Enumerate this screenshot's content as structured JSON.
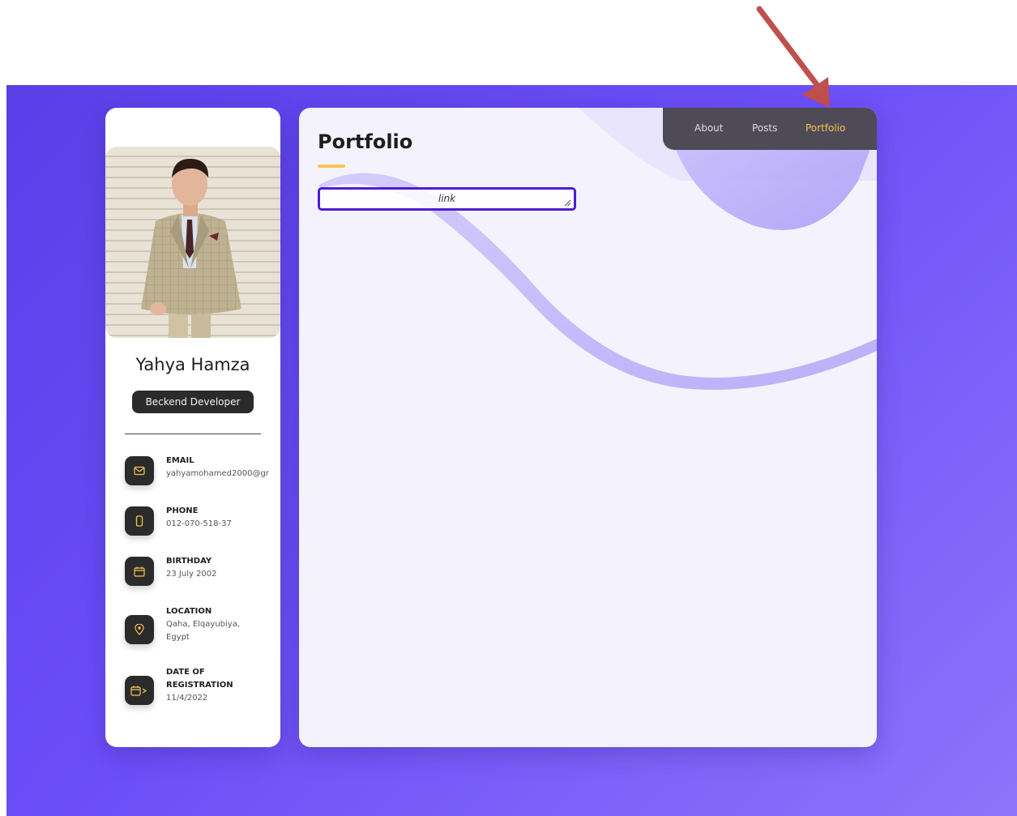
{
  "profile": {
    "name": "Yahya Hamza",
    "role": "Beckend Developer"
  },
  "contacts": [
    {
      "label": "EMAIL",
      "value": "yahyamohamed2000@gr",
      "icon": "mail-icon"
    },
    {
      "label": "PHONE",
      "value": "012-070-518-37",
      "icon": "phone-icon"
    },
    {
      "label": "BIRTHDAY",
      "value": "23 July 2002",
      "icon": "calendar-icon"
    },
    {
      "label": "LOCATION",
      "value": "Qaha, Elqayubiya, Egypt",
      "icon": "location-pin-icon"
    },
    {
      "label": "DATE OF REGISTRATION",
      "value": "11/4/2022",
      "icon": "calendar-arrow-icon"
    }
  ],
  "nav": {
    "items": [
      "About",
      "Posts",
      "Portfolio"
    ],
    "active": "Portfolio"
  },
  "main": {
    "title": "Portfolio",
    "link_value": "link"
  },
  "colors": {
    "background": "#6b4ef7",
    "accent": "#f6c453",
    "dark": "#2b2b2b",
    "field_border": "#4b1fd1",
    "annotation_arrow": "#c0504d"
  }
}
